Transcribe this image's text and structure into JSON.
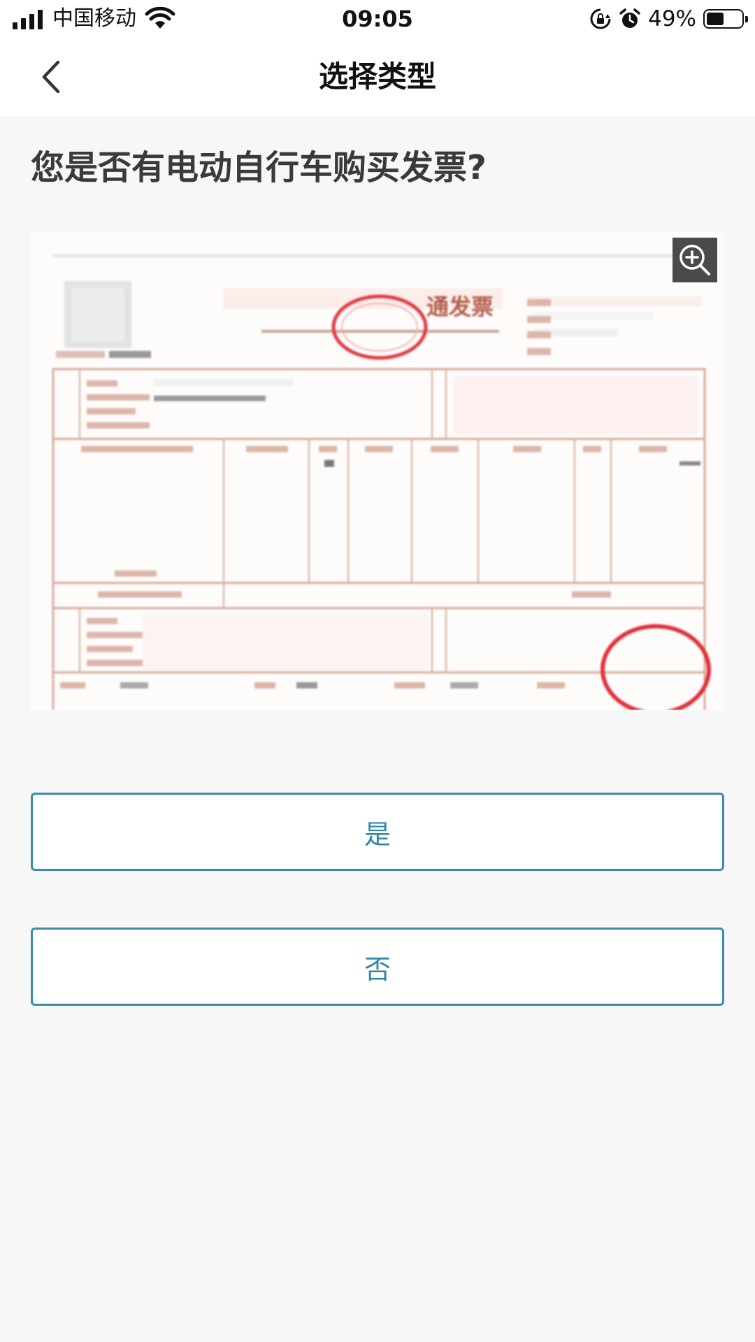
{
  "status_bar": {
    "carrier": "中国移动",
    "time": "09:05",
    "battery_percent": "49%",
    "battery_level": 0.49,
    "icons": [
      "signal-icon",
      "wifi-icon",
      "rotation-lock-icon",
      "alarm-icon",
      "battery-icon"
    ]
  },
  "nav": {
    "title": "选择类型",
    "back_icon": "chevron-left-icon"
  },
  "question": "您是否有电动自行车购买发票?",
  "invoice": {
    "title_fragment": "通发票",
    "zoom_icon": "zoom-in-icon"
  },
  "choices": {
    "yes_label": "是",
    "no_label": "否"
  },
  "colors": {
    "accent": "#2f86a6",
    "button_border": "#3a8eaa",
    "background": "#f7f7f7",
    "invoice_line": "#d9a998",
    "stamp_red": "#e0303a"
  }
}
